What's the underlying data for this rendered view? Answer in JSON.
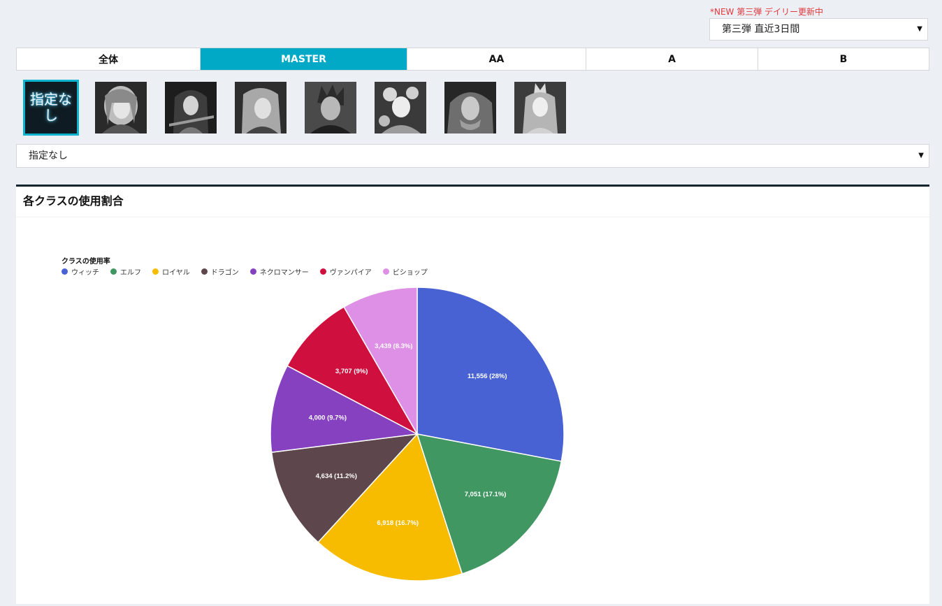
{
  "header": {
    "notice": "*NEW 第三弾 デイリー更新中",
    "period_select": "第三弾 直近3日間"
  },
  "tabs": [
    {
      "label": "全体",
      "active": false
    },
    {
      "label": "MASTER",
      "active": true
    },
    {
      "label": "AA",
      "active": false
    },
    {
      "label": "A",
      "active": false
    },
    {
      "label": "B",
      "active": false
    }
  ],
  "leaders": {
    "none_label": "指定なし",
    "selected": "指定なし"
  },
  "card": {
    "title": "各クラスの使用割合"
  },
  "colors": {
    "accent": "#02a9c7",
    "card_border": "#11252e",
    "notice": "#e0383e"
  },
  "chart_data": {
    "type": "pie",
    "title": "クラスの使用率",
    "legend_position": "top-left",
    "series": [
      {
        "name": "ウィッチ",
        "value": 11556,
        "label": "11,556 (28%)",
        "color": "#4862d4"
      },
      {
        "name": "エルフ",
        "value": 7051,
        "label": "7,051 (17.1%)",
        "color": "#419762"
      },
      {
        "name": "ロイヤル",
        "value": 6918,
        "label": "6,918 (16.7%)",
        "color": "#f7bb00"
      },
      {
        "name": "ドラゴン",
        "value": 4634,
        "label": "4,634 (11.2%)",
        "color": "#5e474c"
      },
      {
        "name": "ネクロマンサー",
        "value": 4000,
        "label": "4,000 (9.7%)",
        "color": "#8641c1"
      },
      {
        "name": "ヴァンパイア",
        "value": 3707,
        "label": "3,707 (9%)",
        "color": "#cf103f"
      },
      {
        "name": "ビショップ",
        "value": 3439,
        "label": "3,439 (8.3%)",
        "color": "#de8fe6"
      }
    ]
  }
}
